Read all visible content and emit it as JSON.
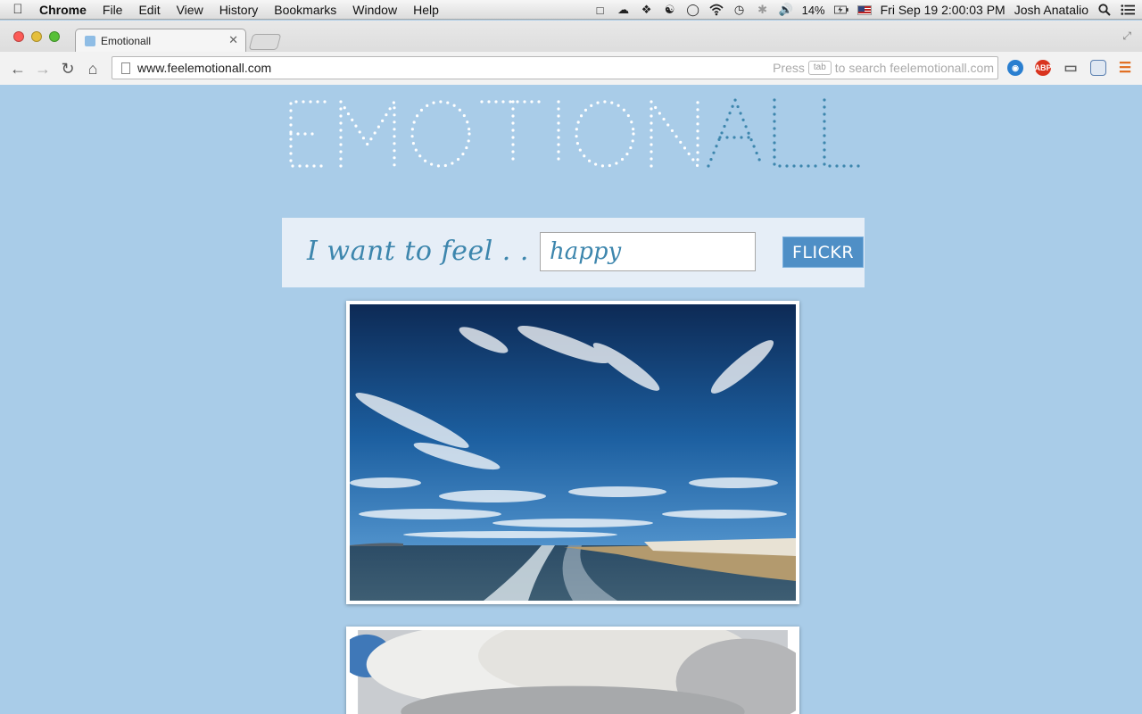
{
  "menubar": {
    "app_name": "Chrome",
    "menus": [
      "File",
      "Edit",
      "View",
      "History",
      "Bookmarks",
      "Window",
      "Help"
    ],
    "battery": "14%",
    "clock": "Fri Sep 19  2:00:03 PM",
    "user": "Josh Anatalio"
  },
  "browser": {
    "tab_title": "Emotionall",
    "url": "www.feelemotionall.com",
    "search_hint_pre": "Press",
    "search_hint_key": "tab",
    "search_hint_post": "to search feelemotionall.com",
    "extensions": [
      {
        "name": "browser-extension-icon",
        "label": "",
        "color": "#2a7fd0"
      },
      {
        "name": "adblock-plus-icon",
        "label": "ABP",
        "color": "#d9341f"
      },
      {
        "name": "cast-icon",
        "label": "",
        "color": "#888888"
      },
      {
        "name": "window-icon",
        "label": "",
        "color": "#5a7fb0"
      }
    ]
  },
  "site": {
    "logo_text": "EMOTIONALL",
    "logo_colors": {
      "white_part": "#ffffff",
      "blue_part": "#3d86ad"
    },
    "feel_label": "I want to feel . . .",
    "emotion_value": "happy",
    "submit_label": "FLICKR"
  },
  "colors": {
    "page_bg": "#a9cce8",
    "panel_bg": "#e6eef7",
    "button": "#4f8fc6",
    "accent_text": "#3d86ad"
  }
}
